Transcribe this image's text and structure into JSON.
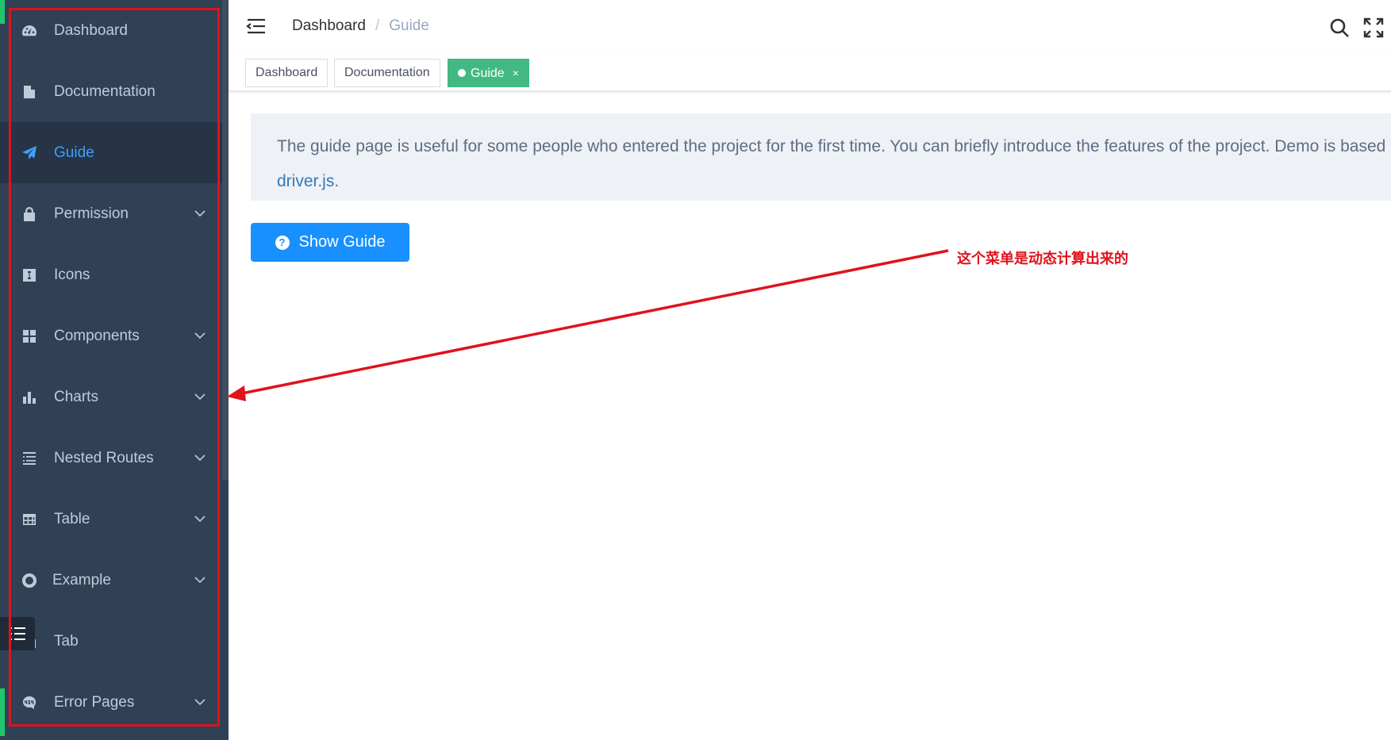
{
  "sidebar": {
    "items": [
      {
        "label": "Dashboard",
        "icon": "dashboard-icon",
        "has_submenu": false,
        "active": false
      },
      {
        "label": "Documentation",
        "icon": "documentation-icon",
        "has_submenu": false,
        "active": false
      },
      {
        "label": "Guide",
        "icon": "guide-icon",
        "has_submenu": false,
        "active": true
      },
      {
        "label": "Permission",
        "icon": "lock-icon",
        "has_submenu": true,
        "active": false
      },
      {
        "label": "Icons",
        "icon": "icons-icon",
        "has_submenu": false,
        "active": false
      },
      {
        "label": "Components",
        "icon": "components-icon",
        "has_submenu": true,
        "active": false
      },
      {
        "label": "Charts",
        "icon": "chart-icon",
        "has_submenu": true,
        "active": false
      },
      {
        "label": "Nested Routes",
        "icon": "nested-icon",
        "has_submenu": true,
        "active": false
      },
      {
        "label": "Table",
        "icon": "table-icon",
        "has_submenu": true,
        "active": false
      },
      {
        "label": "Example",
        "icon": "example-icon",
        "has_submenu": true,
        "active": false
      },
      {
        "label": "Tab",
        "icon": "tab-icon",
        "has_submenu": false,
        "active": false
      },
      {
        "label": "Error Pages",
        "icon": "error-404-icon",
        "has_submenu": true,
        "active": false
      }
    ]
  },
  "navbar": {
    "breadcrumb": [
      "Dashboard",
      "Guide"
    ],
    "breadcrumb_separator": "/"
  },
  "tags": [
    {
      "label": "Dashboard",
      "active": false
    },
    {
      "label": "Documentation",
      "active": false
    },
    {
      "label": "Guide",
      "active": true,
      "close": "×"
    }
  ],
  "content": {
    "description_line1": "The guide page is useful for some people who entered the project for the first time. You can briefly introduce the features of the project. Demo is based on",
    "description_line2": "driver.js.",
    "button_label": "Show Guide",
    "button_icon_glyph": "?"
  },
  "annotation": {
    "text": "这个菜单是动态计算出来的"
  },
  "colors": {
    "sidebar_bg": "#304156",
    "sidebar_active_bg": "#263445",
    "sidebar_active_text": "#409eff",
    "tag_active": "#42b983",
    "button_primary": "#1890ff",
    "annotation_red": "#e0121c"
  }
}
